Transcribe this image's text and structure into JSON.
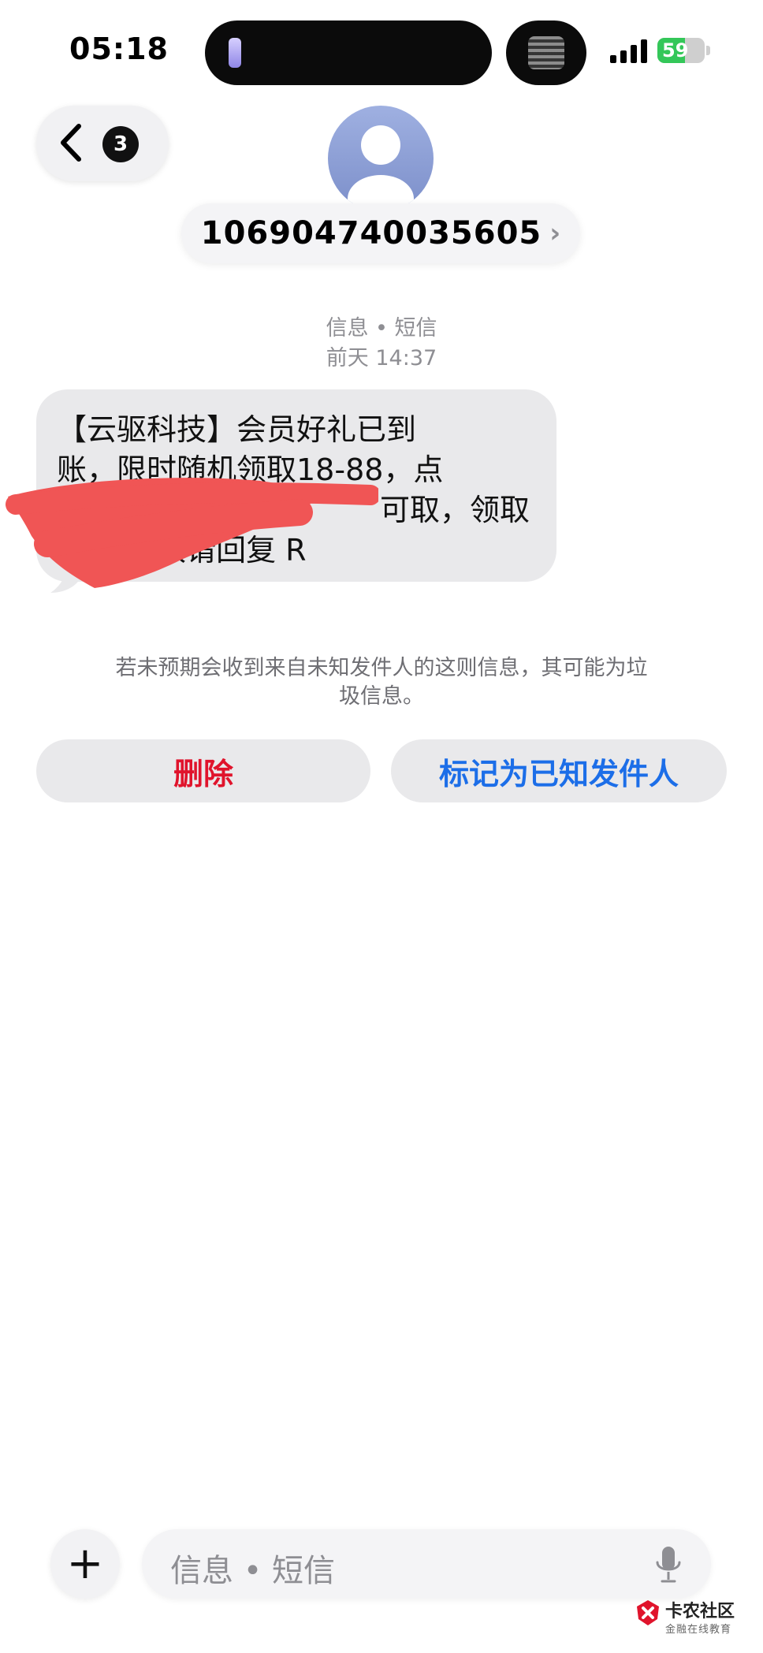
{
  "status_bar": {
    "time": "05:18",
    "battery": "59",
    "battery_level": 0.59
  },
  "header": {
    "back_badge_count": "3",
    "contact_number": "106904740035605"
  },
  "conversation": {
    "channel": "信息 • 短信",
    "timestamp": "前天 14:37",
    "message_lines": [
      "【云驱科技】会员好礼已到",
      "账，限时随机领取18-88，点",
      "可取，领取",
      "码 ，拒收请回复 R"
    ]
  },
  "notice": {
    "text": "若未预期会收到来自未知发件人的这则信息，其可能为垃圾信息。"
  },
  "actions": {
    "delete_label": "删除",
    "mark_known_label": "标记为已知发件人"
  },
  "composer": {
    "placeholder": "信息 • 短信"
  },
  "watermark": {
    "title": "卡农社区",
    "subtitle": "金融在线教育"
  },
  "colors": {
    "delete": "#e0142c",
    "link": "#1c6ee8",
    "bubble": "#e9e9eb",
    "battery": "#34c759"
  }
}
